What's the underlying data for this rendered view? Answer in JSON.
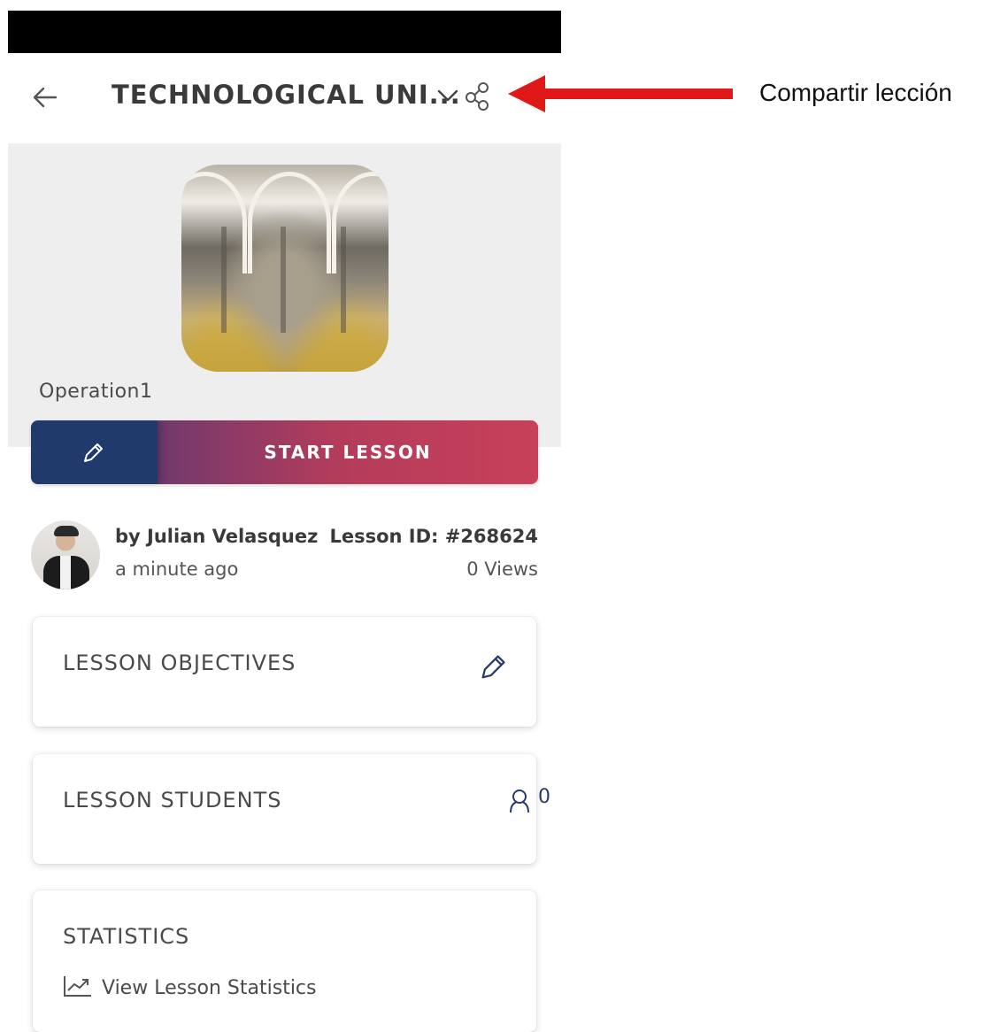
{
  "header": {
    "title": "TECHNOLOGICAL UNI...",
    "back_icon": "arrow-left-icon",
    "dropdown_icon": "chevron-down-icon",
    "share_icon": "share-icon"
  },
  "annotation": {
    "label": "Compartir lección",
    "arrow_color": "#e01818"
  },
  "hero": {
    "operation_name": "Operation1"
  },
  "actions": {
    "start_label": "START LESSON",
    "edit_icon": "pencil-icon"
  },
  "author": {
    "by": "by Julian Velasquez",
    "time": "a minute ago",
    "lesson_id": "Lesson ID: #268624",
    "views": "0 Views"
  },
  "cards": {
    "objectives_title": "LESSON OBJECTIVES",
    "students_title": "LESSON STUDENTS",
    "students_count": "0",
    "statistics_title": "STATISTICS",
    "statistics_link": "View Lesson Statistics"
  },
  "colors": {
    "navy": "#1f3a6b",
    "crimson": "#c8405a",
    "hero_bg": "#eeeeee"
  }
}
